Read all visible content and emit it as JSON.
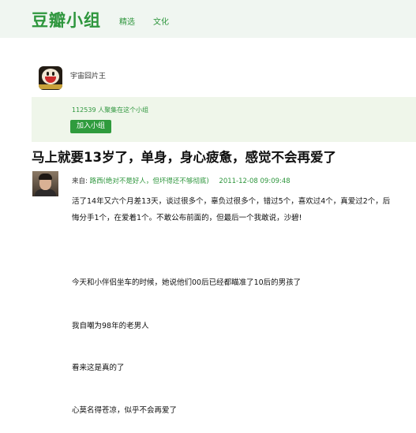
{
  "header": {
    "brand": "豆瓣小组",
    "nav": [
      "精选",
      "文化"
    ]
  },
  "group": {
    "name": "宇宙囧片王",
    "member_count": "112539 人聚集在这个小组",
    "join_label": "加入小组"
  },
  "post": {
    "title": "马上就要13岁了，单身，身心疲惫，感觉不会再爱了",
    "author_prefix": "来自:",
    "author": "路西(绝对不是好人，但坏得还不够彻底)",
    "date": "2011-12-08 09:09:48",
    "paragraphs": [
      "活了14年又六个月差13天，谈过很多个，辜负过很多个，错过5个，喜欢过4个，真爱过2个，后悔分手1个，在爱着1个。不敢公布前面的，但最后一个我敢说，沙碧!",
      "今天和小伴侣坐车的时候，她说他们00后已经都瞄准了10后的男孩了",
      "我自嘲为98年的老男人",
      "看来这是真的了",
      "心莫名得苍凉，似乎不会再爱了"
    ]
  }
}
